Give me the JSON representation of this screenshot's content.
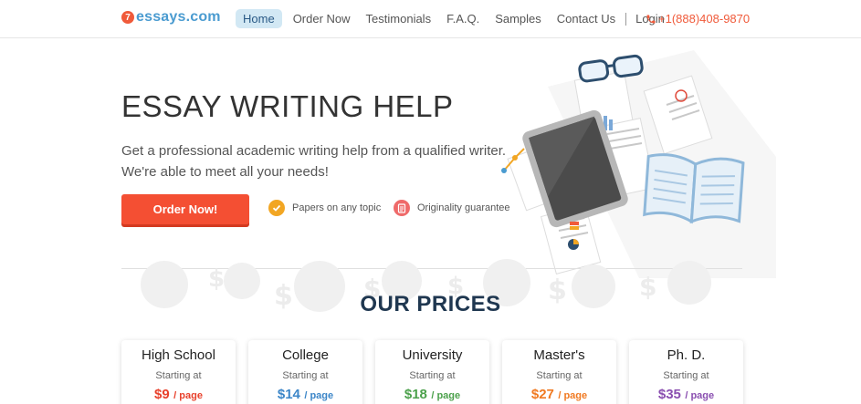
{
  "header": {
    "logo_badge": "7",
    "logo_text": "essays.com",
    "nav": [
      {
        "label": "Home",
        "active": true
      },
      {
        "label": "Order Now"
      },
      {
        "label": "Testimonials"
      },
      {
        "label": "F.A.Q."
      },
      {
        "label": "Samples"
      },
      {
        "label": "Contact Us"
      },
      {
        "label": "Login"
      }
    ],
    "phone": "+1(888)408-9870"
  },
  "hero": {
    "title": "ESSAY WRITING HELP",
    "subtitle_line1": "Get a professional academic writing help from a qualified writer.",
    "subtitle_line2": "We're able to meet all your needs!",
    "order_button": "Order Now!",
    "features": [
      {
        "label": "Papers on any topic",
        "icon": "check-badge-icon"
      },
      {
        "label": "Originality guarantee",
        "icon": "document-icon"
      }
    ]
  },
  "prices": {
    "title": "OUR PRICES",
    "starting_label": "Starting at",
    "unit": "/ page",
    "items": [
      {
        "name": "High School",
        "price": "$9",
        "color": "#e8412c"
      },
      {
        "name": "College",
        "price": "$14",
        "color": "#3c86c8"
      },
      {
        "name": "University",
        "price": "$18",
        "color": "#4ca14c"
      },
      {
        "name": "Master's",
        "price": "$27",
        "color": "#f07a22"
      },
      {
        "name": "Ph. D.",
        "price": "$35",
        "color": "#8a4fb0"
      }
    ]
  },
  "colors": {
    "accent": "#f44f33",
    "brand_blue": "#4a9bd0",
    "heading_dark": "#1f3750"
  }
}
